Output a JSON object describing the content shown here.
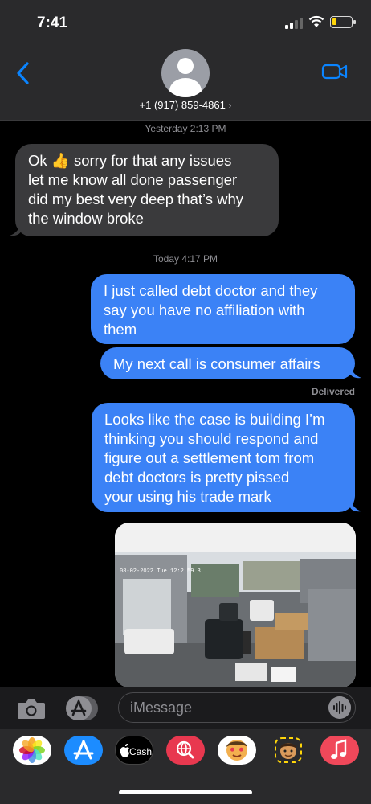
{
  "status_bar": {
    "time": "7:41"
  },
  "header": {
    "contact": "+1 (917) 859-4861",
    "chevron": "›"
  },
  "thread": {
    "stamp1": "Yesterday 2:13 PM",
    "msg_in_1": [
      "Ok 👍 sorry for that any issues",
      "let me know all done passenger",
      "did my best very deep that’s why",
      "the window broke"
    ],
    "stamp2": "Today 4:17 PM",
    "msg_out_1": [
      "I just called debt doctor and they",
      "say you have no affiliation with",
      "them"
    ],
    "msg_out_2": "My next call is consumer affairs",
    "delivered": "Delivered",
    "msg_out_3": [
      "Looks like the case is building I’m",
      "thinking you should respond and",
      "figure out a settlement tom from",
      "debt doctors is pretty pissed",
      "your using his trade mark"
    ],
    "photo": {
      "overlay_text": "08-02-2022 Tue 12:2 59 3"
    }
  },
  "input": {
    "placeholder": "iMessage"
  },
  "drawer": {
    "apps": [
      {
        "name": "photos-app",
        "icon": "photos-icon"
      },
      {
        "name": "app-store-app",
        "icon": "app-store-icon"
      },
      {
        "name": "apple-cash-app",
        "label": "Cash",
        "icon": "apple-icon"
      },
      {
        "name": "images-search-app",
        "icon": "globe-search-icon"
      },
      {
        "name": "memoji-stickers-app",
        "icon": "memoji-icon"
      },
      {
        "name": "animoji-app",
        "icon": "animoji-icon"
      },
      {
        "name": "music-app",
        "icon": "music-note-icon"
      }
    ]
  },
  "colors": {
    "outgoing_bubble": "#3b82f6",
    "incoming_bubble": "#3a3a3c",
    "accent": "#0a84ff"
  }
}
